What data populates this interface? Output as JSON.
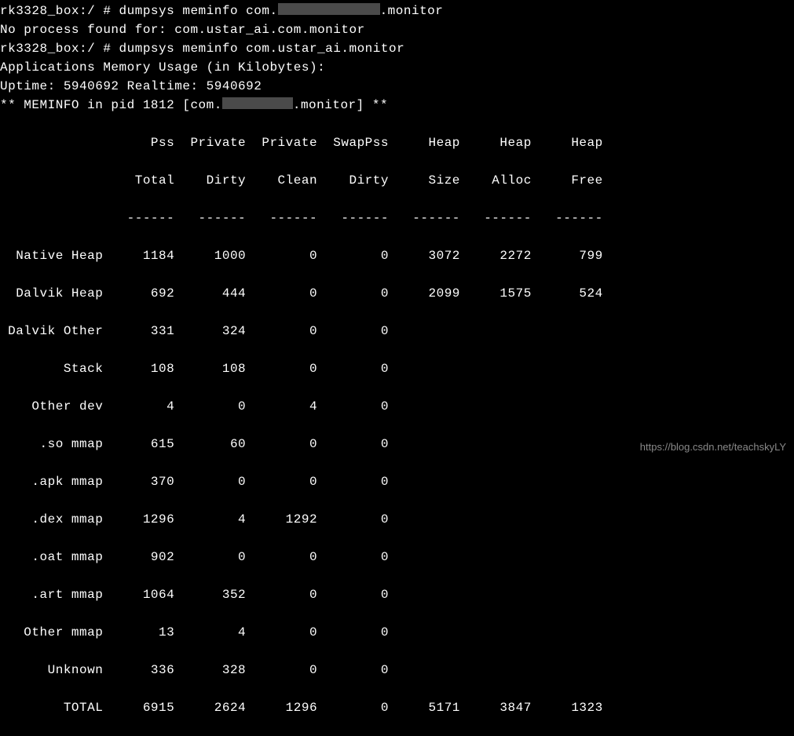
{
  "prompt1_prefix": "rk3328_box:/ # dumpsys meminfo com.",
  "prompt1_suffix": ".monitor",
  "line2": "No process found for: com.ustar_ai.com.monitor",
  "line3": "rk3328_box:/ # dumpsys meminfo com.ustar_ai.monitor",
  "line4": "Applications Memory Usage (in Kilobytes):",
  "line5": "Uptime: 5940692 Realtime: 5940692",
  "line6": "",
  "meminfo_prefix": "** MEMINFO in pid 1812 [com.",
  "meminfo_suffix": ".monitor] **",
  "chart_data": {
    "type": "table",
    "title": "Memory Info",
    "columns": [
      "",
      "Pss Total",
      "Private Dirty",
      "Private Clean",
      "SwapPss Dirty",
      "Heap Size",
      "Heap Alloc",
      "Heap Free"
    ],
    "rows": [
      {
        "label": "Native Heap",
        "pss_total": 1184,
        "priv_dirty": 1000,
        "priv_clean": 0,
        "swap_pss": 0,
        "heap_size": 3072,
        "heap_alloc": 2272,
        "heap_free": 799
      },
      {
        "label": "Dalvik Heap",
        "pss_total": 692,
        "priv_dirty": 444,
        "priv_clean": 0,
        "swap_pss": 0,
        "heap_size": 2099,
        "heap_alloc": 1575,
        "heap_free": 524
      },
      {
        "label": "Dalvik Other",
        "pss_total": 331,
        "priv_dirty": 324,
        "priv_clean": 0,
        "swap_pss": 0
      },
      {
        "label": "Stack",
        "pss_total": 108,
        "priv_dirty": 108,
        "priv_clean": 0,
        "swap_pss": 0
      },
      {
        "label": "Other dev",
        "pss_total": 4,
        "priv_dirty": 0,
        "priv_clean": 4,
        "swap_pss": 0
      },
      {
        "label": ".so mmap",
        "pss_total": 615,
        "priv_dirty": 60,
        "priv_clean": 0,
        "swap_pss": 0
      },
      {
        "label": ".apk mmap",
        "pss_total": 370,
        "priv_dirty": 0,
        "priv_clean": 0,
        "swap_pss": 0
      },
      {
        "label": ".dex mmap",
        "pss_total": 1296,
        "priv_dirty": 4,
        "priv_clean": 1292,
        "swap_pss": 0
      },
      {
        "label": ".oat mmap",
        "pss_total": 902,
        "priv_dirty": 0,
        "priv_clean": 0,
        "swap_pss": 0
      },
      {
        "label": ".art mmap",
        "pss_total": 1064,
        "priv_dirty": 352,
        "priv_clean": 0,
        "swap_pss": 0
      },
      {
        "label": "Other mmap",
        "pss_total": 13,
        "priv_dirty": 4,
        "priv_clean": 0,
        "swap_pss": 0
      },
      {
        "label": "Unknown",
        "pss_total": 336,
        "priv_dirty": 328,
        "priv_clean": 0,
        "swap_pss": 0
      },
      {
        "label": "TOTAL",
        "pss_total": 6915,
        "priv_dirty": 2624,
        "priv_clean": 1296,
        "swap_pss": 0,
        "heap_size": 5171,
        "heap_alloc": 3847,
        "heap_free": 1323
      }
    ]
  },
  "header_line1": "                   Pss  Private  Private  SwapPss     Heap     Heap     Heap",
  "header_line2": "                 Total    Dirty    Clean    Dirty     Size    Alloc     Free",
  "header_line3": "                ------   ------   ------   ------   ------   ------   ------",
  "row_native": "  Native Heap     1184     1000        0        0     3072     2272      799",
  "row_dalvik": "  Dalvik Heap      692      444        0        0     2099     1575      524",
  "row_dalviko": " Dalvik Other      331      324        0        0",
  "row_stack": "        Stack      108      108        0        0",
  "row_otherdev": "    Other dev        4        0        4        0",
  "row_so": "     .so mmap      615       60        0        0",
  "row_apk": "    .apk mmap      370        0        0        0",
  "row_dex": "    .dex mmap     1296        4     1292        0",
  "row_oat": "    .oat mmap      902        0        0        0",
  "row_art": "    .art mmap     1064      352        0        0",
  "row_othermm": "   Other mmap       13        4        0        0",
  "row_unknown": "      Unknown      336      328        0        0",
  "row_total": "        TOTAL     6915     2624     1296        0     5171     3847     1323",
  "watermark": "https://blog.csdn.net/teachskyLY"
}
